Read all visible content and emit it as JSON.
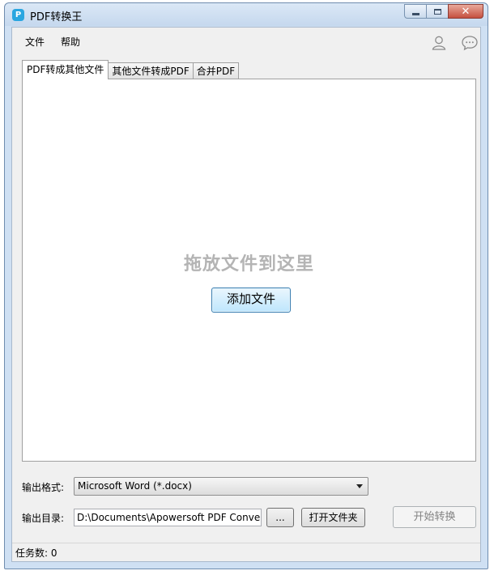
{
  "window": {
    "title": "PDF转换王",
    "app_icon_glyph": "P"
  },
  "caption": {
    "close_glyph": "✕"
  },
  "menu": {
    "file": "文件",
    "help": "帮助"
  },
  "tabs": [
    {
      "label": "PDF转成其他文件",
      "active": true
    },
    {
      "label": "其他文件转成PDF",
      "active": false
    },
    {
      "label": "合并PDF",
      "active": false
    }
  ],
  "drop_zone": {
    "hint": "拖放文件到这里",
    "add_button": "添加文件"
  },
  "output": {
    "format_label": "输出格式:",
    "format_value": "Microsoft Word (*.docx)",
    "dir_label": "输出目录:",
    "dir_value": "D:\\Documents\\Apowersoft PDF Converter",
    "browse_label": "...",
    "open_folder_label": "打开文件夹",
    "start_label": "开始转换"
  },
  "status": {
    "task_count": "任务数: 0"
  },
  "colors": {
    "accent": "#2aa6e0",
    "frame": "#cfe0f3",
    "hint_gray": "#b4b4b4"
  },
  "icons": {
    "account": "user-icon",
    "feedback": "chat-bubble-icon"
  }
}
